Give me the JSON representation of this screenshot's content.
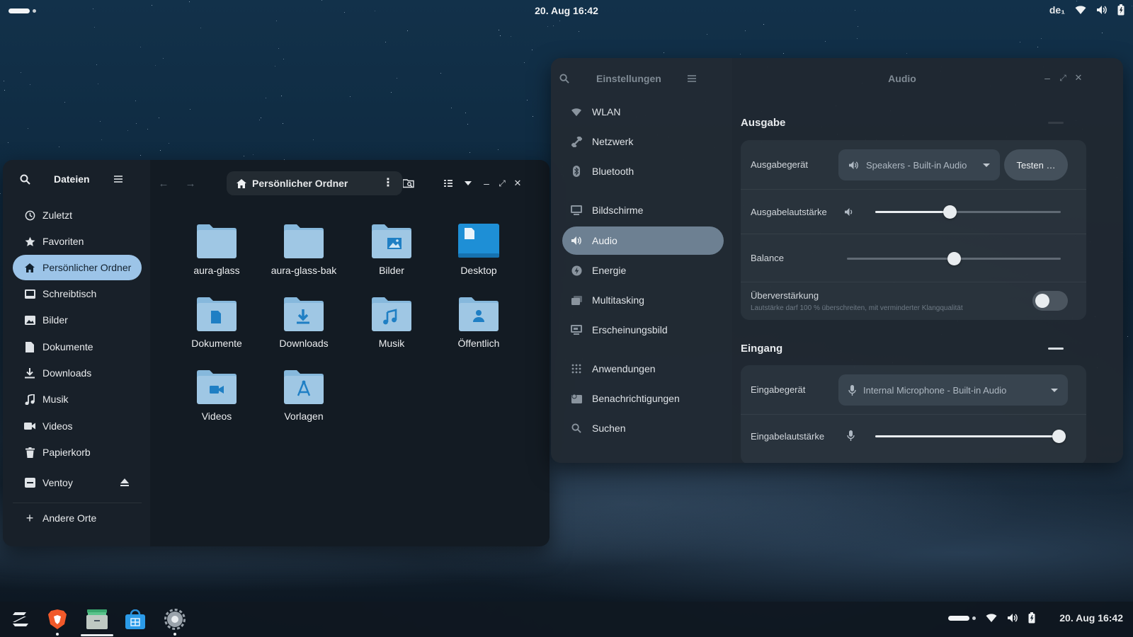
{
  "topbar": {
    "datetime": "20. Aug  16:42",
    "keyboard_layout": "de₁",
    "icons": [
      "wifi-icon",
      "volume-icon",
      "battery-icon"
    ]
  },
  "files_window": {
    "app_title": "Dateien",
    "location": "Persönlicher Ordner",
    "sidebar": [
      {
        "label": "Zuletzt",
        "icon": "clock-icon"
      },
      {
        "label": "Favoriten",
        "icon": "star-icon"
      },
      {
        "label": "Persönlicher Ordner",
        "icon": "home-icon",
        "active": true
      },
      {
        "label": "Schreibtisch",
        "icon": "desktop-icon"
      },
      {
        "label": "Bilder",
        "icon": "image-icon"
      },
      {
        "label": "Dokumente",
        "icon": "document-icon"
      },
      {
        "label": "Downloads",
        "icon": "download-icon"
      },
      {
        "label": "Musik",
        "icon": "music-icon"
      },
      {
        "label": "Videos",
        "icon": "video-icon"
      },
      {
        "label": "Papierkorb",
        "icon": "trash-icon"
      }
    ],
    "devices": [
      {
        "label": "Ventoy",
        "icon": "drive-icon"
      }
    ],
    "other_places": "Andere Orte",
    "folders": [
      {
        "label": "aura-glass",
        "emblem": ""
      },
      {
        "label": "aura-glass-bak",
        "emblem": ""
      },
      {
        "label": "Bilder",
        "emblem": "image"
      },
      {
        "label": "Desktop",
        "emblem": "desktop"
      },
      {
        "label": "Dokumente",
        "emblem": "document"
      },
      {
        "label": "Downloads",
        "emblem": "download"
      },
      {
        "label": "Musik",
        "emblem": "music"
      },
      {
        "label": "Öffentlich",
        "emblem": "person"
      },
      {
        "label": "Videos",
        "emblem": "video"
      },
      {
        "label": "Vorlagen",
        "emblem": "template"
      }
    ]
  },
  "settings_window": {
    "app_title": "Einstellungen",
    "page_title": "Audio",
    "sidebar": [
      {
        "label": "WLAN",
        "icon": "wifi-icon"
      },
      {
        "label": "Netzwerk",
        "icon": "network-icon"
      },
      {
        "label": "Bluetooth",
        "icon": "bluetooth-icon"
      },
      {
        "label": "Bildschirme",
        "icon": "display-icon"
      },
      {
        "label": "Audio",
        "icon": "speaker-icon",
        "active": true
      },
      {
        "label": "Energie",
        "icon": "power-icon"
      },
      {
        "label": "Multitasking",
        "icon": "multitasking-icon"
      },
      {
        "label": "Erscheinungsbild",
        "icon": "appearance-icon"
      },
      {
        "label": "Anwendungen",
        "icon": "apps-grid-icon"
      },
      {
        "label": "Benachrichtigungen",
        "icon": "notification-icon"
      },
      {
        "label": "Suchen",
        "icon": "search-icon"
      }
    ],
    "output": {
      "title": "Ausgabe",
      "device_label": "Ausgabegerät",
      "device_value": "Speakers - Built-in Audio",
      "test_button": "Testen …",
      "volume_label": "Ausgabelautstärke",
      "volume_level": 0.4,
      "balance_label": "Balance",
      "balance_level": 0.5,
      "overamp_label": "Überverstärkung",
      "overamp_hint": "Lautstärke darf 100 % überschreiten, mit verminderter Klangqualität",
      "overamp_enabled": false
    },
    "input": {
      "title": "Eingang",
      "device_label": "Eingabegerät",
      "device_value": "Internal Microphone - Built-in Audio",
      "volume_label": "Eingabelautstärke",
      "volume_level": 0.99
    }
  },
  "dock": {
    "apps": [
      {
        "name": "zorin-menu-icon"
      },
      {
        "name": "brave-browser-icon"
      },
      {
        "name": "files-app-icon",
        "running": true
      },
      {
        "name": "software-store-icon"
      },
      {
        "name": "settings-app-icon",
        "running": true
      }
    ],
    "datetime": "20. Aug  16:42"
  },
  "colors": {
    "accent": "#9cc4e8",
    "folder": "#9fc7e4",
    "folder_emblem": "#1f7fc4",
    "desktop_folder": "#1e8fd6"
  }
}
